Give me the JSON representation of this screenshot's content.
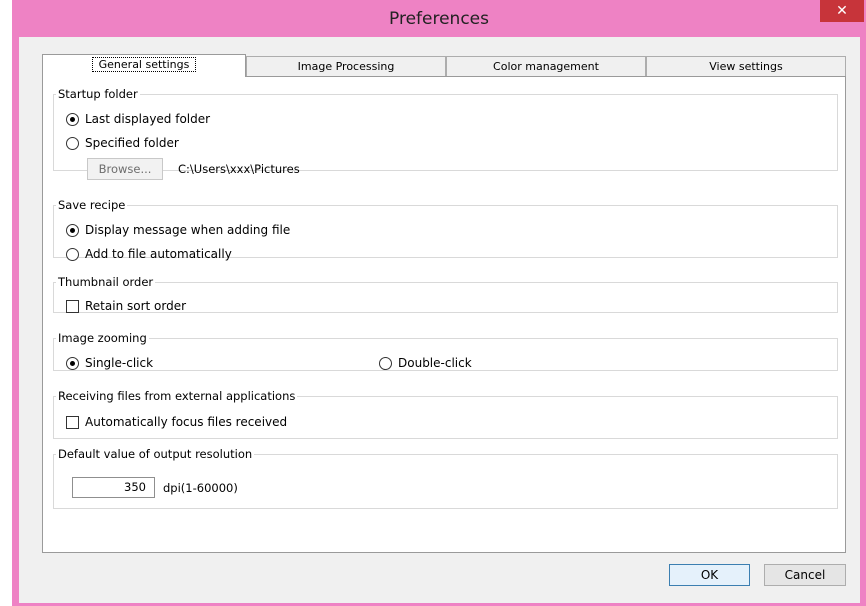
{
  "window": {
    "title": "Preferences",
    "close_glyph": "✕"
  },
  "tabs": [
    {
      "label": "General settings",
      "active": true
    },
    {
      "label": "Image Processing",
      "active": false
    },
    {
      "label": "Color management",
      "active": false
    },
    {
      "label": "View settings",
      "active": false
    }
  ],
  "startup_folder": {
    "title": "Startup folder",
    "options": [
      "Last displayed folder",
      "Specified folder"
    ],
    "selected": "Last displayed folder",
    "browse_label": "Browse...",
    "path": "C:\\Users\\xxx\\Pictures"
  },
  "save_recipe": {
    "title": "Save recipe",
    "options": [
      "Display message when adding file",
      "Add to file automatically"
    ],
    "selected": "Display message when adding file"
  },
  "thumbnail_order": {
    "title": "Thumbnail order",
    "retain_label": "Retain sort order",
    "retain_checked": false
  },
  "image_zooming": {
    "title": "Image zooming",
    "options": [
      "Single-click",
      "Double-click"
    ],
    "selected": "Single-click"
  },
  "receiving_files": {
    "title": "Receiving files from external applications",
    "focus_label": "Automatically focus files received",
    "focus_checked": false
  },
  "output_resolution": {
    "title": "Default value of output resolution",
    "value": "350",
    "unit": "dpi(1-60000)"
  },
  "buttons": {
    "ok": "OK",
    "cancel": "Cancel"
  },
  "colors": {
    "title_bar": "#ee82c4",
    "close_button": "#c7343a",
    "default_button_border": "#3c7fb1"
  }
}
